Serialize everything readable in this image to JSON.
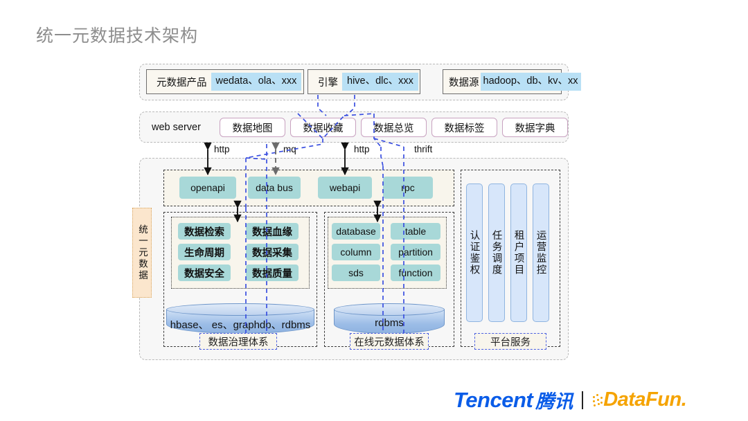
{
  "title": "统一元数据技术架构",
  "top_row": {
    "groups": [
      {
        "label": "元数据产品",
        "value": "wedata、ola、xxx"
      },
      {
        "label": "引擎",
        "value": "hive、dlc、xxx"
      },
      {
        "label": "数据源",
        "value": "hadoop、db、kv、xx"
      }
    ]
  },
  "web_server": {
    "label": "web server",
    "buttons": [
      "数据地图",
      "数据收藏",
      "数据总览",
      "数据标签",
      "数据字典"
    ]
  },
  "protocols": [
    "http",
    "mq",
    "http",
    "thrift"
  ],
  "api_layer": {
    "items": [
      "openapi",
      "data bus",
      "webapi",
      "rpc"
    ]
  },
  "governance": {
    "section_label": "数据治理体系",
    "col_left": [
      "数据检索",
      "生命周期",
      "数据安全"
    ],
    "col_right": [
      "数据血缘",
      "数据采集",
      "数据质量"
    ],
    "storage": "hbase、 es、graphdb、rdbms"
  },
  "online_meta": {
    "section_label": "在线元数据体系",
    "col_left": [
      "database",
      "column",
      "sds"
    ],
    "col_right": [
      "table",
      "partition",
      "function"
    ],
    "storage": "rdbms"
  },
  "platform": {
    "section_label": "平台服务",
    "bars": [
      "认证鉴权",
      "任务调度",
      "租户项目",
      "运营监控"
    ]
  },
  "left_tab": {
    "label": "统一元数据"
  },
  "footer": {
    "tencent_en": "Tencent",
    "tencent_cn": "腾讯",
    "datafun": "DataFun."
  },
  "colors": {
    "highlight": "#b9e0f5",
    "chip": "#a8d8d8",
    "ws_border": "#c8a2c0",
    "vbar": "#d7e6fa",
    "left_tab": "#fbe6cd",
    "blue_dash": "#4a5fe0",
    "title_gray": "#8d8d8d",
    "tencent_blue": "#0a5ce8",
    "datafun_orange": "#f5a300"
  }
}
